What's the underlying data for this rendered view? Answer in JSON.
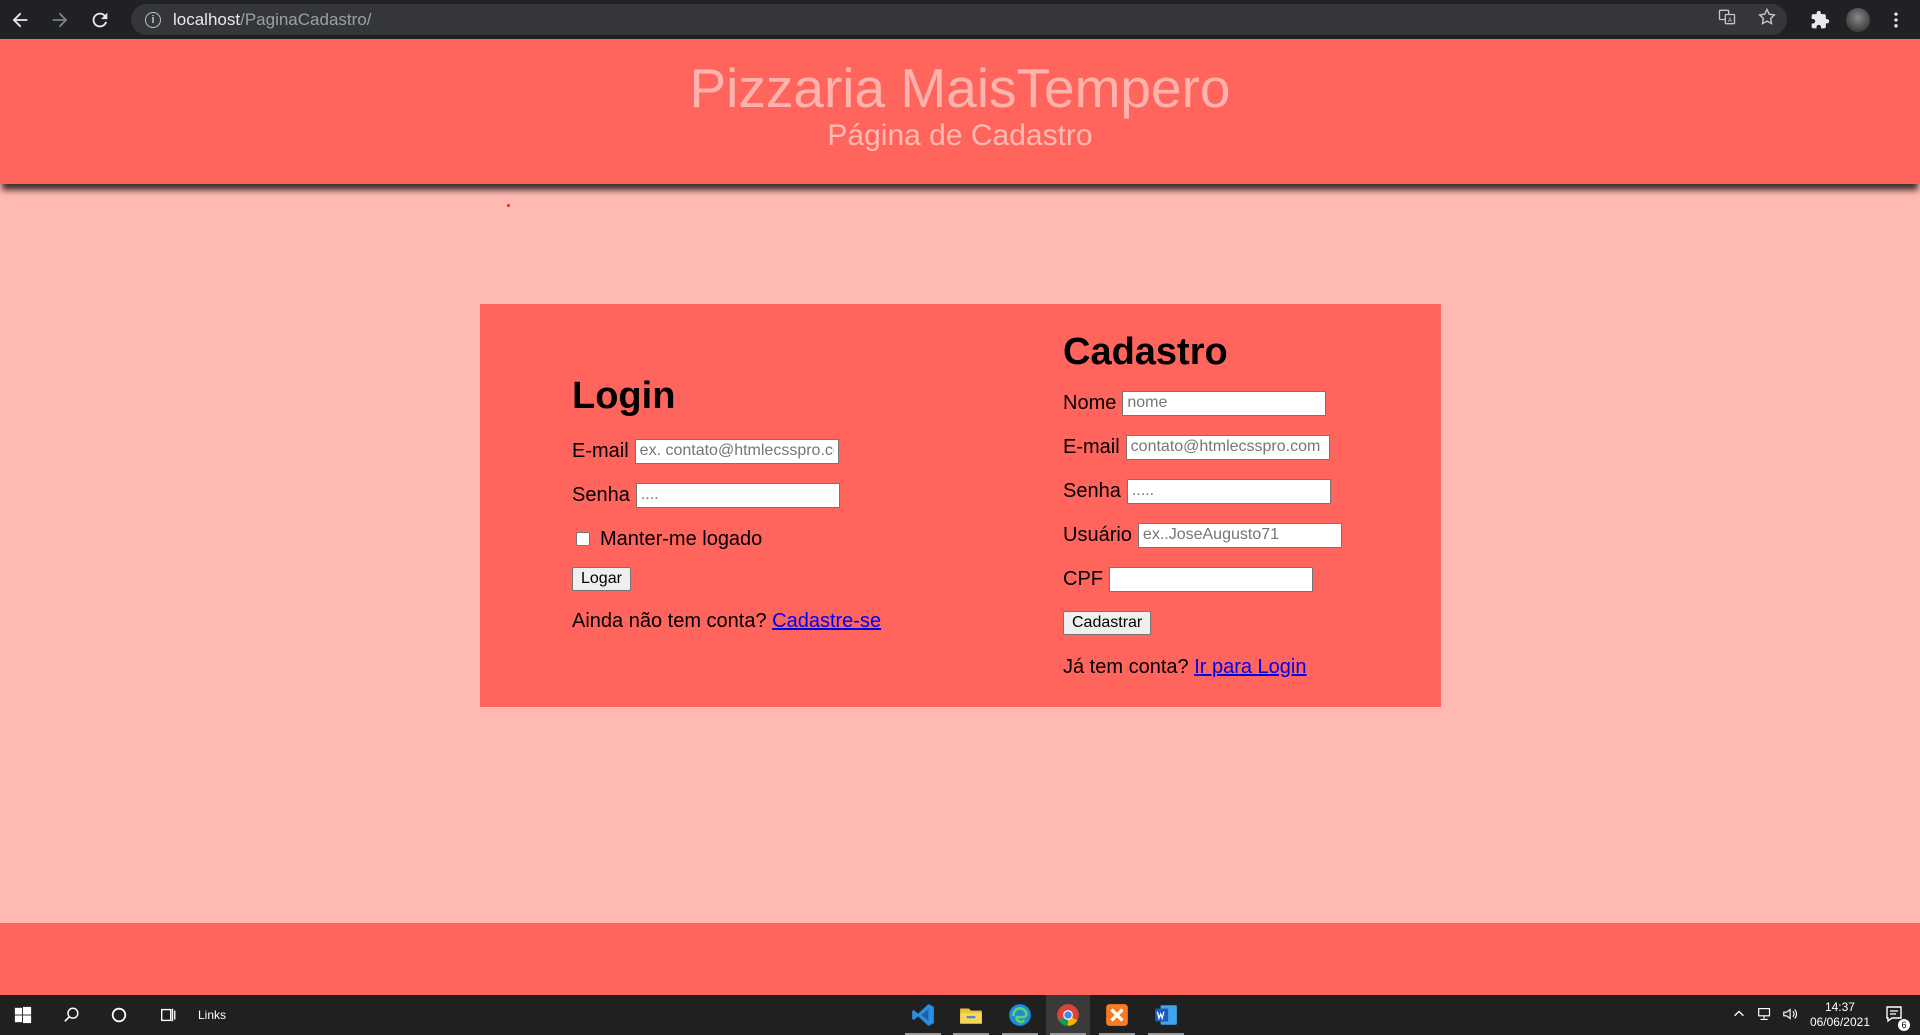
{
  "browser": {
    "url_host": "localhost",
    "url_path": "/PaginaCadastro/"
  },
  "header": {
    "title": "Pizzaria MaisTempero",
    "subtitle": "Página de Cadastro"
  },
  "login": {
    "heading": "Login",
    "email_label": "E-mail",
    "email_placeholder": "ex. contato@htmlecsspro.com",
    "password_label": "Senha",
    "password_placeholder": "....",
    "remember_label": "Manter-me logado",
    "submit_label": "Logar",
    "no_account_text": "Ainda não tem conta?",
    "signup_link": "Cadastre-se"
  },
  "cadastro": {
    "heading": "Cadastro",
    "name_label": "Nome",
    "name_placeholder": "nome",
    "email_label": "E-mail",
    "email_placeholder": "contato@htmlecsspro.com",
    "password_label": "Senha",
    "password_placeholder": ".....",
    "user_label": "Usuário",
    "user_placeholder": "ex..JoseAugusto71",
    "cpf_label": "CPF",
    "cpf_placeholder": "",
    "submit_label": "Cadastrar",
    "has_account_text": "Já tem conta?",
    "login_link": "Ir para Login"
  },
  "taskbar": {
    "links_label": "Links",
    "time": "14:37",
    "date": "06/06/2021",
    "notification_count": "6",
    "apps": [
      "vscode-icon",
      "file-explorer-icon",
      "edge-icon",
      "chrome-icon",
      "xampp-icon",
      "word-icon"
    ]
  }
}
